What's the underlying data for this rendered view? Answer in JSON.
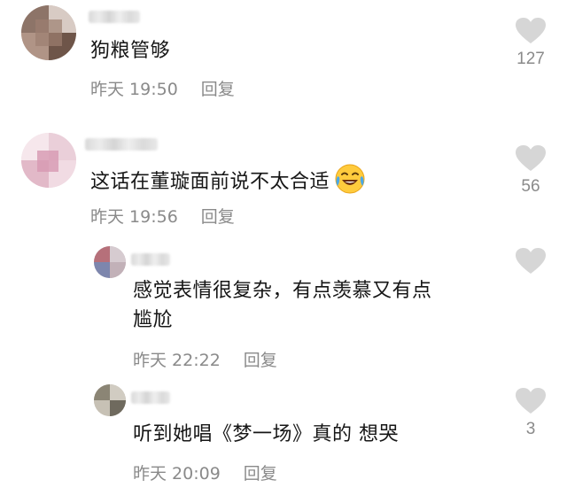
{
  "comments": [
    {
      "text": "狗粮管够",
      "time": "昨天 19:50",
      "reply_label": "回复",
      "likes": "127"
    },
    {
      "text": "这话在董璇面前说不太合适",
      "emoji": "laughing-crying-emoji",
      "time": "昨天 19:56",
      "reply_label": "回复",
      "likes": "56",
      "replies": [
        {
          "text_line1": "感觉表情很复杂，有点羡慕又有点",
          "text_line2": "尴尬",
          "time": "昨天 22:22",
          "reply_label": "回复",
          "likes": ""
        },
        {
          "text": "听到她唱《梦一场》真的 想哭",
          "time": "昨天 20:09",
          "reply_label": "回复",
          "likes": "3"
        }
      ]
    }
  ],
  "icons": {
    "like": "heart-icon",
    "like_color": "#d6d6d6"
  }
}
